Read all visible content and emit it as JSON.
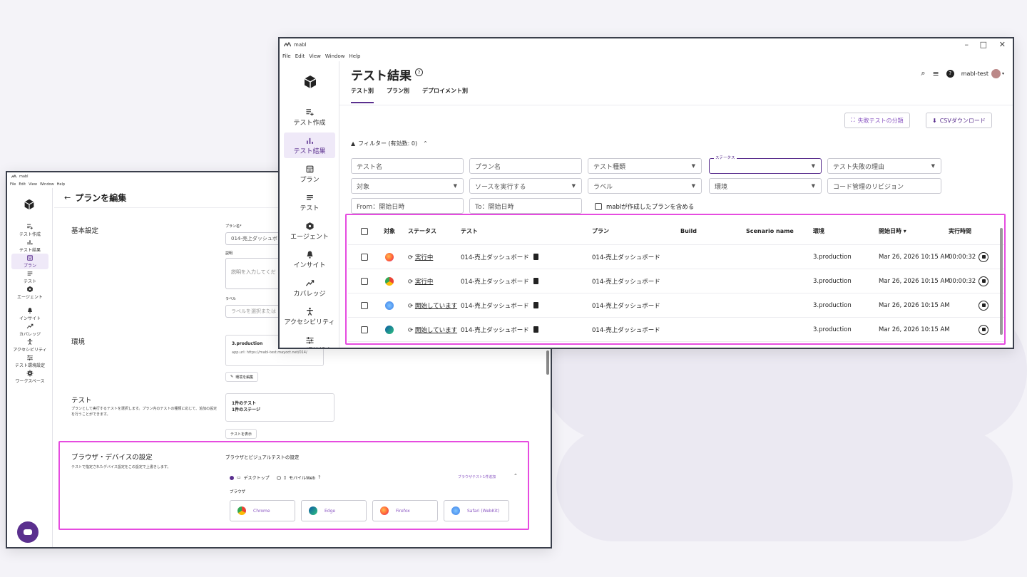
{
  "app_name": "mabl",
  "menu": [
    "File",
    "Edit",
    "View",
    "Window",
    "Help"
  ],
  "window_controls": [
    "–",
    "□",
    "✕"
  ],
  "back_window": {
    "page_title": "プランを編集",
    "nav": [
      {
        "label": "テスト作成",
        "icon": "list-add-icon",
        "active": false
      },
      {
        "label": "テスト結果",
        "icon": "bar-chart-icon",
        "active": false
      },
      {
        "label": "プラン",
        "icon": "calendar-icon",
        "active": true
      },
      {
        "label": "テスト",
        "icon": "list-icon",
        "active": false
      },
      {
        "label": "エージェント",
        "icon": "agent-icon",
        "active": false
      },
      {
        "label": "インサイト",
        "icon": "bell-icon",
        "active": false
      },
      {
        "label": "カバレッジ",
        "icon": "trend-icon",
        "active": false
      },
      {
        "label": "アクセシビリティ",
        "icon": "accessibility-icon",
        "active": false
      },
      {
        "label": "テスト環境設定",
        "icon": "sliders-icon",
        "active": false
      },
      {
        "label": "ワークスペース",
        "icon": "gear-icon",
        "active": false
      }
    ],
    "basic": {
      "heading": "基本設定",
      "plan_name_label": "プラン名*",
      "plan_name_value": "014-売上ダッシュボ",
      "desc_label": "説明",
      "desc_placeholder": "説明を入力してくだ",
      "label_label": "ラベル",
      "label_placeholder": "ラベルを選択または"
    },
    "env": {
      "heading": "環境",
      "env_name": "3.production",
      "env_url": "app.url: https://mabl-test.mayoct.net/014/",
      "edit_button": "環境を編集"
    },
    "test": {
      "heading": "テスト",
      "description": "プランとして実行するテストを選択します。プラン内のテストの種類に応じて、追加の設定を行うことができます。",
      "count_tests": "1件のテスト",
      "count_stages": "1件のステージ",
      "show_button": "テストを表示"
    },
    "browser": {
      "heading": "ブラウザ・デバイスの設定",
      "description": "テストで指定されたデバイス設定をこの設定で上書きします。",
      "subheading": "ブラウザとビジュアルテストの設定",
      "option_desktop": "デスクトップ",
      "option_mobile": "モバイルWeb",
      "add_link": "ブラウザテスト1件追加",
      "browser_label": "ブラウザ",
      "browsers": [
        "Chrome",
        "Edge",
        "Firefox",
        "Safari (WebKit)"
      ]
    }
  },
  "front_window": {
    "page_title": "テスト結果",
    "tabs": [
      "テスト別",
      "プラン別",
      "デプロイメント別"
    ],
    "active_tab": 0,
    "user": "mabl-test",
    "nav": [
      {
        "label": "テスト作成",
        "icon": "list-add-icon",
        "active": false
      },
      {
        "label": "テスト結果",
        "icon": "bar-chart-icon",
        "active": true
      },
      {
        "label": "プラン",
        "icon": "calendar-icon",
        "active": false
      },
      {
        "label": "テスト",
        "icon": "list-icon",
        "active": false
      },
      {
        "label": "エージェント",
        "icon": "agent-icon",
        "active": false
      },
      {
        "label": "インサイト",
        "icon": "bell-icon",
        "active": false
      },
      {
        "label": "カバレッジ",
        "icon": "trend-icon",
        "active": false
      },
      {
        "label": "アクセシビリティ",
        "icon": "accessibility-icon",
        "active": false
      },
      {
        "label": "テスト環境設定",
        "icon": "sliders-icon",
        "active": false
      }
    ],
    "buttons": {
      "classify": "失敗テストの分類",
      "csv": "CSVダウンロード"
    },
    "filter_toggle": "フィルター (有効数: 0)",
    "filters": {
      "test_name": "テスト名",
      "plan_name": "プラン名",
      "test_type": "テスト種類",
      "status_label": "ステータス",
      "fail_reason": "テスト失敗の理由",
      "target": "対象",
      "source": "ソースを実行する",
      "label": "ラベル",
      "environment": "環境",
      "revision": "コード管理のリビジョン",
      "from": "From：開始日時",
      "to": "To：開始日時",
      "include_mabl": "mablが作成したプランを含める"
    },
    "table": {
      "columns": [
        "対象",
        "ステータス",
        "テスト",
        "プラン",
        "Build",
        "Scenario name",
        "環境",
        "開始日時 ▾",
        "実行時間"
      ],
      "rows": [
        {
          "browser": "firefox",
          "status": "実行中",
          "test": "014-売上ダッシュボード",
          "plan": "014-売上ダッシュボード",
          "env": "3.production",
          "start": "Mar 26, 2026 10:15 AM",
          "duration": "00:00:32"
        },
        {
          "browser": "chrome",
          "status": "実行中",
          "test": "014-売上ダッシュボード",
          "plan": "014-売上ダッシュボード",
          "env": "3.production",
          "start": "Mar 26, 2026 10:15 AM",
          "duration": "00:00:32"
        },
        {
          "browser": "safari",
          "status": "開始しています",
          "test": "014-売上ダッシュボード",
          "plan": "014-売上ダッシュボード",
          "env": "3.production",
          "start": "Mar 26, 2026 10:15 AM",
          "duration": ""
        },
        {
          "browser": "edge",
          "status": "開始しています",
          "test": "014-売上ダッシュボード",
          "plan": "014-売上ダッシュボード",
          "env": "3.production",
          "start": "Mar 26, 2026 10:15 AM",
          "duration": ""
        }
      ]
    }
  },
  "colors": {
    "accent": "#5a2f8e",
    "highlight": "#e64ce0",
    "link": "#5a2f8e"
  }
}
